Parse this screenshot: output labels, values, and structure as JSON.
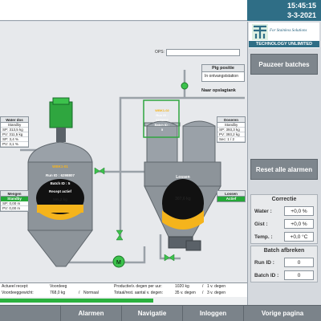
{
  "header": {
    "time": "15:45:15",
    "date": "3-3-2021"
  },
  "ops": {
    "label": "OPS:",
    "value": ""
  },
  "logo": {
    "tagline": "For Stainless Solutions",
    "company": "TECHNOLOGY UNLIMITED"
  },
  "side_buttons": {
    "pause": "Pauzeer batches",
    "reset": "Reset alle alarmen"
  },
  "correction": {
    "title": "Correctie",
    "rows": [
      {
        "label": "Water :",
        "value": "+0,0 %"
      },
      {
        "label": "Gist :",
        "value": "+0,0 %"
      },
      {
        "label": "Temp. :",
        "value": "+0,0 °C"
      }
    ]
  },
  "batch_abort": {
    "title": "Batch afbreken",
    "rows": [
      {
        "label": "Run ID :",
        "value": "0"
      },
      {
        "label": "Batch ID :",
        "value": "0"
      }
    ]
  },
  "water_box": {
    "title": "Water dos",
    "status": "Standby",
    "rows": [
      "SP: 313,5   kg",
      "PV: 311,5   kg",
      "SP:     3,4   %",
      "PV:     3,1   %"
    ]
  },
  "mengen_box": {
    "title": "Mengen",
    "status": "Standby",
    "rows": [
      "SP:    0,00  m",
      "PV:    0,00  m"
    ]
  },
  "doseren_box": {
    "title": "Doseren",
    "status": "Standby",
    "rows": [
      "SP: 393,3   kg",
      "PV: 393,2   kg",
      "Sec:    1 / 2"
    ]
  },
  "lossen_box": {
    "title": "Lossen",
    "status": "Actief"
  },
  "pig": {
    "title": "Pig positie",
    "value": "In ontvangststation"
  },
  "pipe_label": "Naar opslagtank",
  "tank_left": {
    "name": "WBK1-01",
    "run": "Run ID : 6298807",
    "batch": "Batch ID : 5",
    "recipe": "Recept actief",
    "weight": "595,2 kg"
  },
  "tank_right": {
    "name": "WBK1-02",
    "run": "Run ID :",
    "run_no": "6298807",
    "batch": "Batch ID :",
    "batch_no": "5",
    "state": "Lossen",
    "weight": "307,6 kg"
  },
  "info": {
    "recipe_label": "Actueel recept:",
    "recipe": "Voordeeg",
    "weight_label": "Voordeeggewicht:",
    "weight": "768,0 kg",
    "mode_sep": "/",
    "mode": "Normaal",
    "prod_label": "Productie/v. degen per uur:",
    "prod": "1020 kg",
    "prod_sep": "/",
    "prod_count": "1 v. degen",
    "total_label": "Totaal/rest. aantal v. degen:",
    "total": "35 v. degen",
    "total_sep": "/",
    "rest": "3 v. degen"
  },
  "progress": {
    "fraction": 0.62
  },
  "nav": [
    "Alarmen",
    "Navigatie",
    "Inloggen",
    "Vorige pagina"
  ],
  "colors": {
    "accent": "#2f6e86",
    "active_green": "#25a838",
    "button_gray": "#7e868d"
  }
}
